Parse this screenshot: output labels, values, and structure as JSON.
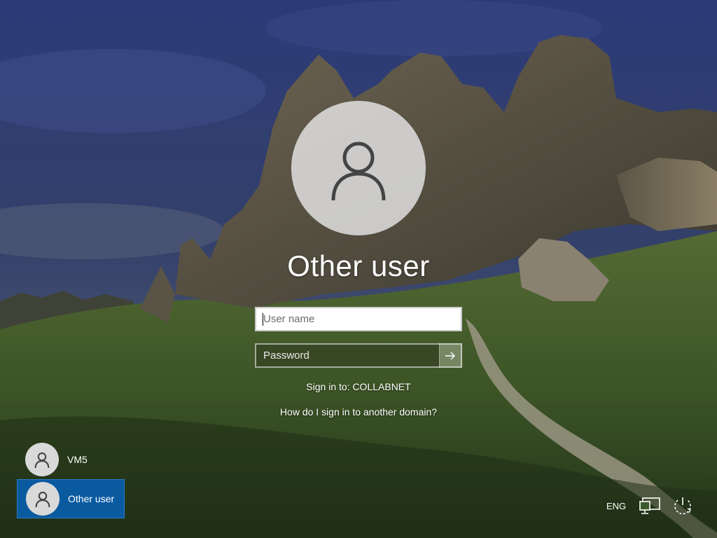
{
  "login": {
    "title": "Other user",
    "username_placeholder": "User name",
    "password_placeholder": "Password",
    "sign_in_to": "Sign in to: COLLABNET",
    "domain_help_link": "How do I sign in to another domain?"
  },
  "users": [
    {
      "name": "VM5",
      "icon": "person-icon",
      "selected": false
    },
    {
      "name": "Other user",
      "icon": "person-icon",
      "selected": true
    }
  ],
  "tray": {
    "language": "ENG",
    "network_icon": "network-icon",
    "power_icon": "power-icon"
  },
  "colors": {
    "selected_user_bg": "#0a5aa0",
    "sky": "#2e3a6e",
    "grass": "#4f6a2a"
  }
}
